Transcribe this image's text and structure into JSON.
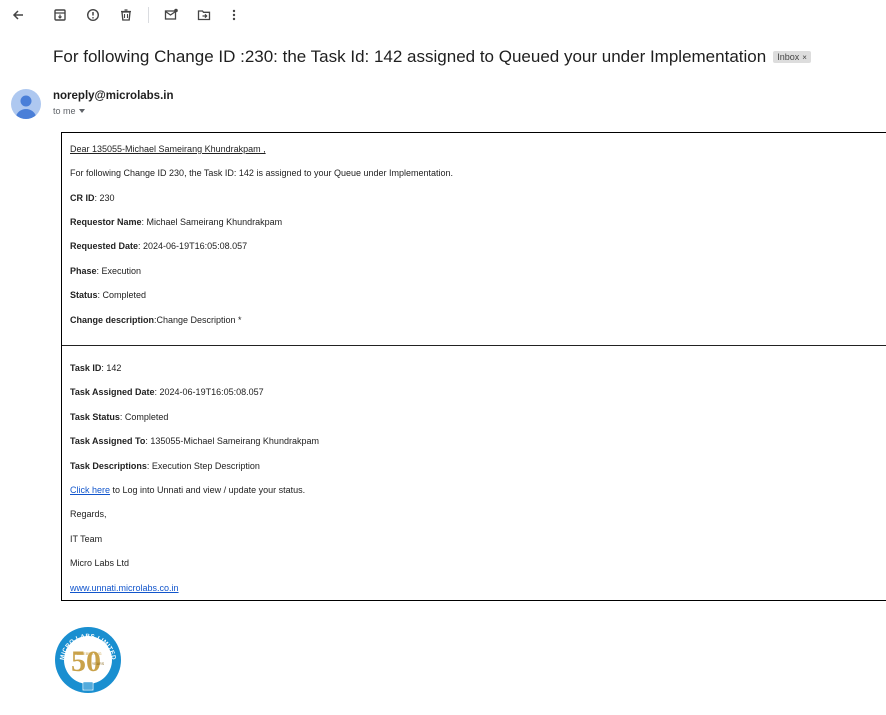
{
  "subject": {
    "text": "For following Change ID :230: the Task Id: 142 assigned to Queued your under Implementation",
    "label_chip": "Inbox",
    "label_chip_close": "×"
  },
  "sender": {
    "email": "noreply@microlabs.in",
    "to_me": "to me"
  },
  "email": {
    "greeting": "Dear 135055-Michael Sameirang Khundrakpam ,",
    "intro": "For following Change ID 230, the Task ID: 142 is assigned to your Queue under Implementation.",
    "cr_id": {
      "label": "CR ID",
      "value": ": 230"
    },
    "requestor": {
      "label": "Requestor Name",
      "value": ": Michael Sameirang Khundrakpam"
    },
    "requested_date": {
      "label": "Requested Date",
      "value": ": 2024-06-19T16:05:08.057"
    },
    "phase": {
      "label": "Phase",
      "value": ": Execution"
    },
    "status": {
      "label": "Status",
      "value": ": Completed"
    },
    "change_description": {
      "label": "Change description",
      "value": ":Change Description *"
    },
    "task_id": {
      "label": "Task ID",
      "value": ": 142"
    },
    "task_assigned_date": {
      "label": "Task Assigned Date",
      "value": ": 2024-06-19T16:05:08.057"
    },
    "task_status": {
      "label": "Task Status",
      "value": ": Completed"
    },
    "task_assigned_to": {
      "label": "Task Assigned To",
      "value": ": 135055-Michael Sameirang Khundrakpam"
    },
    "task_descriptions": {
      "label": "Task Descriptions",
      "value": ": Execution Step Description"
    },
    "click_here": "Click here",
    "click_here_rest": " to Log into Unnati and view / update your status.",
    "regards": "Regards,",
    "team": "IT Team",
    "company": "Micro Labs Ltd",
    "website": "www.unnati.microlabs.co.in"
  },
  "logo": {
    "top_text": "MICRO LABS LIMITED",
    "inner_text": "CELEBRATING",
    "years": "YEARS",
    "number": "50"
  },
  "colors": {
    "link": "#1155cc",
    "logo_blue": "#1a8fd0",
    "logo_gold": "#c9a24a",
    "avatar_bg": "#aec8f0",
    "avatar_fg": "#4a7fd8"
  },
  "icons": [
    "back-arrow-icon",
    "archive-icon",
    "report-spam-icon",
    "delete-icon",
    "mark-unread-icon",
    "move-to-icon",
    "more-options-icon"
  ]
}
